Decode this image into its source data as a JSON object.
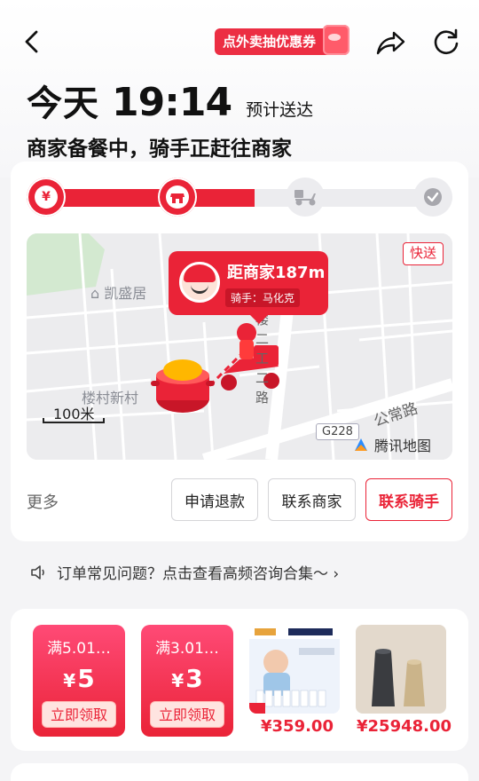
{
  "nav": {
    "promo_label": "点外卖抽优惠券"
  },
  "delivery": {
    "eta_day": "今天",
    "eta_time": "19:14",
    "eta_suffix": "预计送达",
    "status": "商家备餐中，骑手正赶往商家",
    "progress_fraction": 0.535,
    "node_yuan_glyph": "¥"
  },
  "map": {
    "badge": "快送",
    "distance_text": "距商家187m",
    "rider_label": "骑手：马化克",
    "poi_kaisheng": "凯盛居",
    "poi_loucun": "楼村新村",
    "road_gongchang": "公常路",
    "road_vertical": "楼 二 工 二 路",
    "scale_label": "100米",
    "highway_label": "G228",
    "provider": "腾讯地图"
  },
  "actions": {
    "more_label": "更多",
    "refund_label": "申请退款",
    "contact_merchant_label": "联系商家",
    "contact_rider_label": "联系骑手"
  },
  "faq": {
    "text": "订单常见问题？点击查看高频咨询合集～"
  },
  "coupons": [
    {
      "title": "满5.01…",
      "currency": "¥",
      "amount": "5",
      "cta": "立即领取"
    },
    {
      "title": "满3.01…",
      "currency": "¥",
      "amount": "3",
      "cta": "立即领取"
    }
  ],
  "products": [
    {
      "price": "¥359.00"
    },
    {
      "price": "¥25948.00"
    }
  ],
  "colors": {
    "accent": "#ea2337"
  }
}
